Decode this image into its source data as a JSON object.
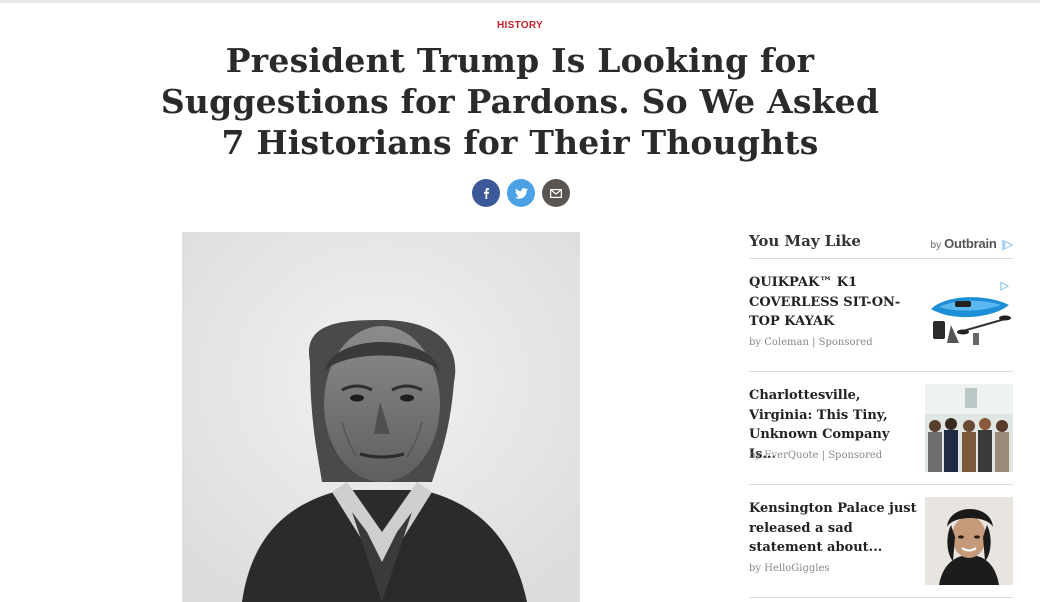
{
  "article": {
    "category": "HISTORY",
    "headline": "President Trump Is Looking for Suggestions for Pardons. So We Asked 7 Historians for Their Thoughts"
  },
  "share": {
    "icons": [
      "facebook-icon",
      "twitter-icon",
      "email-icon"
    ],
    "colors": {
      "facebook": "#3b5998",
      "twitter": "#4ba1e6",
      "email": "#5a5550"
    }
  },
  "sidebar": {
    "title": "You May Like",
    "by": "by",
    "provider": "Outbrain",
    "items": [
      {
        "title": "QUIKPAK™ K1 COVERLESS SIT-ON-TOP KAYAK",
        "source": "by Coleman | Sponsored"
      },
      {
        "title": "Charlottesville, Virginia: This Tiny, Unknown Company Is...",
        "source": "by EverQuote | Sponsored"
      },
      {
        "title": "Kensington Palace just released a sad statement about...",
        "source": "by HelloGiggles"
      }
    ]
  },
  "colors": {
    "category": "#c8202a",
    "headline": "#2a2a2a"
  }
}
